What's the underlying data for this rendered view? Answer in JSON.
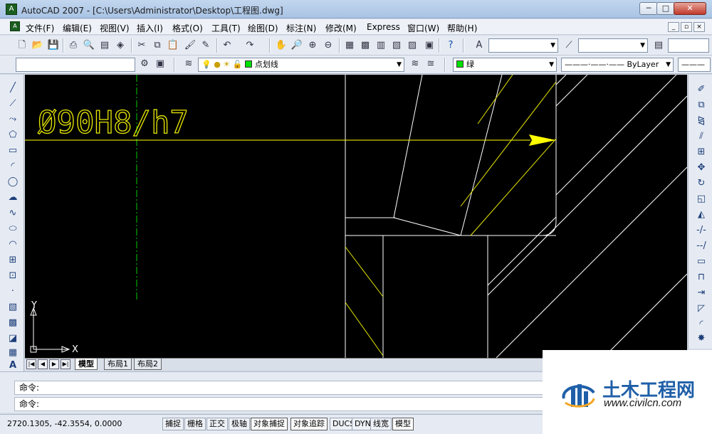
{
  "window": {
    "title": "AutoCAD 2007 - [C:\\Users\\Administrator\\Desktop\\工程图.dwg]",
    "app_icon": "autocad-logo-icon",
    "controls": [
      "─",
      "□",
      "✕"
    ]
  },
  "menu": {
    "items": [
      "文件(F)",
      "编辑(E)",
      "视图(V)",
      "插入(I)",
      "格式(O)",
      "工具(T)",
      "绘图(D)",
      "标注(N)",
      "修改(M)",
      "Express",
      "窗口(W)",
      "帮助(H)"
    ],
    "doc_controls": [
      "_",
      "▫",
      "×"
    ]
  },
  "toolbar_standard": {
    "icons": [
      "new-icon",
      "open-icon",
      "save-icon",
      "print-icon",
      "plot-preview-icon",
      "publish-icon",
      "3d-dwf-icon",
      "cut-icon",
      "copy-icon",
      "paste-icon",
      "match-properties-icon",
      "block-editor-icon",
      "undo-icon",
      "redo-icon",
      "pan-icon",
      "zoom-realtime-icon",
      "zoom-window-icon",
      "zoom-previous-icon",
      "properties-icon",
      "design-center-icon",
      "tool-palettes-icon",
      "sheet-set-icon",
      "markup-icon",
      "quickcalc-icon",
      "help-icon",
      "text-style-icon",
      "dim-style-icon",
      "table-style-icon"
    ]
  },
  "toolbar_layers": {
    "workspace_value": "",
    "layer_value": "点划线",
    "color_value": "绿",
    "color_swatch": "#00e000",
    "linetype_value": "———·——·—— ByLayer",
    "lineweight_value": "———"
  },
  "left_tools": [
    "line-icon",
    "construction-line-icon",
    "polyline-icon",
    "polygon-icon",
    "rectangle-icon",
    "arc-icon",
    "circle-icon",
    "revision-cloud-icon",
    "spline-icon",
    "ellipse-icon",
    "ellipse-arc-icon",
    "insert-block-icon",
    "make-block-icon",
    "point-icon",
    "hatch-icon",
    "gradient-icon",
    "region-icon",
    "table-icon",
    "mtext-icon"
  ],
  "right_tools": [
    "erase-icon",
    "copy-object-icon",
    "mirror-icon",
    "offset-icon",
    "array-icon",
    "move-icon",
    "rotate-icon",
    "scale-icon",
    "stretch-icon",
    "trim-icon",
    "extend-icon",
    "break-at-point-icon",
    "break-icon",
    "join-icon",
    "chamfer-icon",
    "fillet-icon",
    "explode-icon"
  ],
  "drawing": {
    "dimension_text": "Ø90H8/h7",
    "ucs_y": "Y",
    "ucs_x": "X",
    "colors": {
      "background": "#000000",
      "dim": "#ffff00",
      "hatch": "#e6e600",
      "lines": "#ffffff",
      "center_line": "#00cc00"
    }
  },
  "layout_tabs": {
    "nav": [
      "|◀",
      "◀",
      "▶",
      "▶|"
    ],
    "tabs": [
      "模型",
      "布局1",
      "布局2"
    ],
    "active": "模型"
  },
  "command": {
    "line1": "命令:",
    "line2": "命令:"
  },
  "status": {
    "coords": "2720.1305, -42.3554, 0.0000",
    "buttons": [
      "捕捉",
      "栅格",
      "正交",
      "极轴",
      "对象捕捉",
      "对象追踪",
      "DUCS",
      "DYN",
      "线宽",
      "模型"
    ],
    "active": [
      "对象捕捉",
      "对象追踪",
      "模型"
    ]
  },
  "watermark": {
    "title": "土木工程网",
    "url": "www.civilcn.com"
  }
}
